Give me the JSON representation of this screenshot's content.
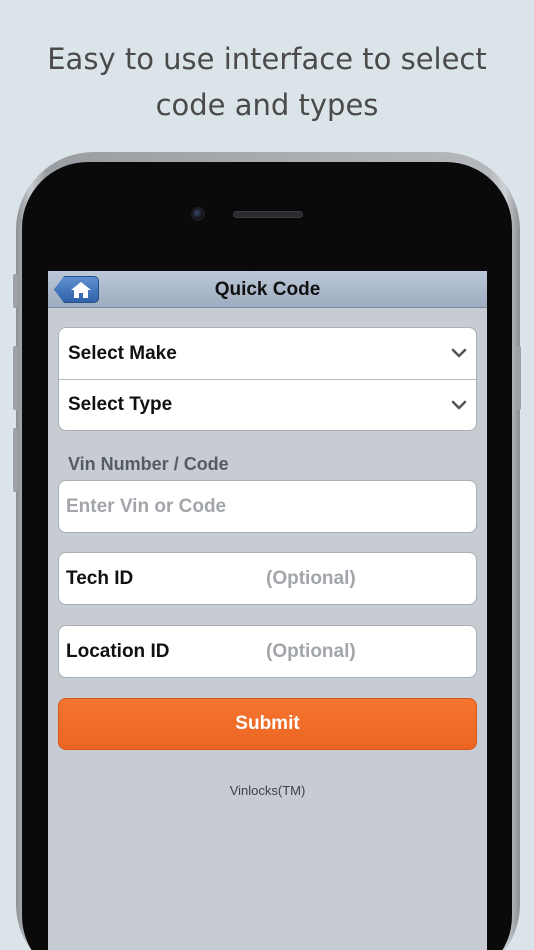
{
  "promo": {
    "line1": "Easy to use interface to select",
    "line2": "code and types"
  },
  "navbar": {
    "title": "Quick Code",
    "home_icon": "home-icon"
  },
  "selects": {
    "make": "Select Make",
    "type": "Select Type"
  },
  "vin": {
    "label": "Vin Number / Code",
    "placeholder": "Enter Vin or Code",
    "value": ""
  },
  "tech_id": {
    "label": "Tech ID",
    "placeholder": "(Optional)"
  },
  "location_id": {
    "label": "Location ID",
    "placeholder": "(Optional)"
  },
  "submit": {
    "label": "Submit"
  },
  "footer": {
    "text": "Vinlocks(TM)"
  },
  "colors": {
    "accent": "#ef6a26",
    "nav_button": "#3b6fb6",
    "screen_bg": "#c7ccd2",
    "page_bg": "#dbe4e8"
  }
}
